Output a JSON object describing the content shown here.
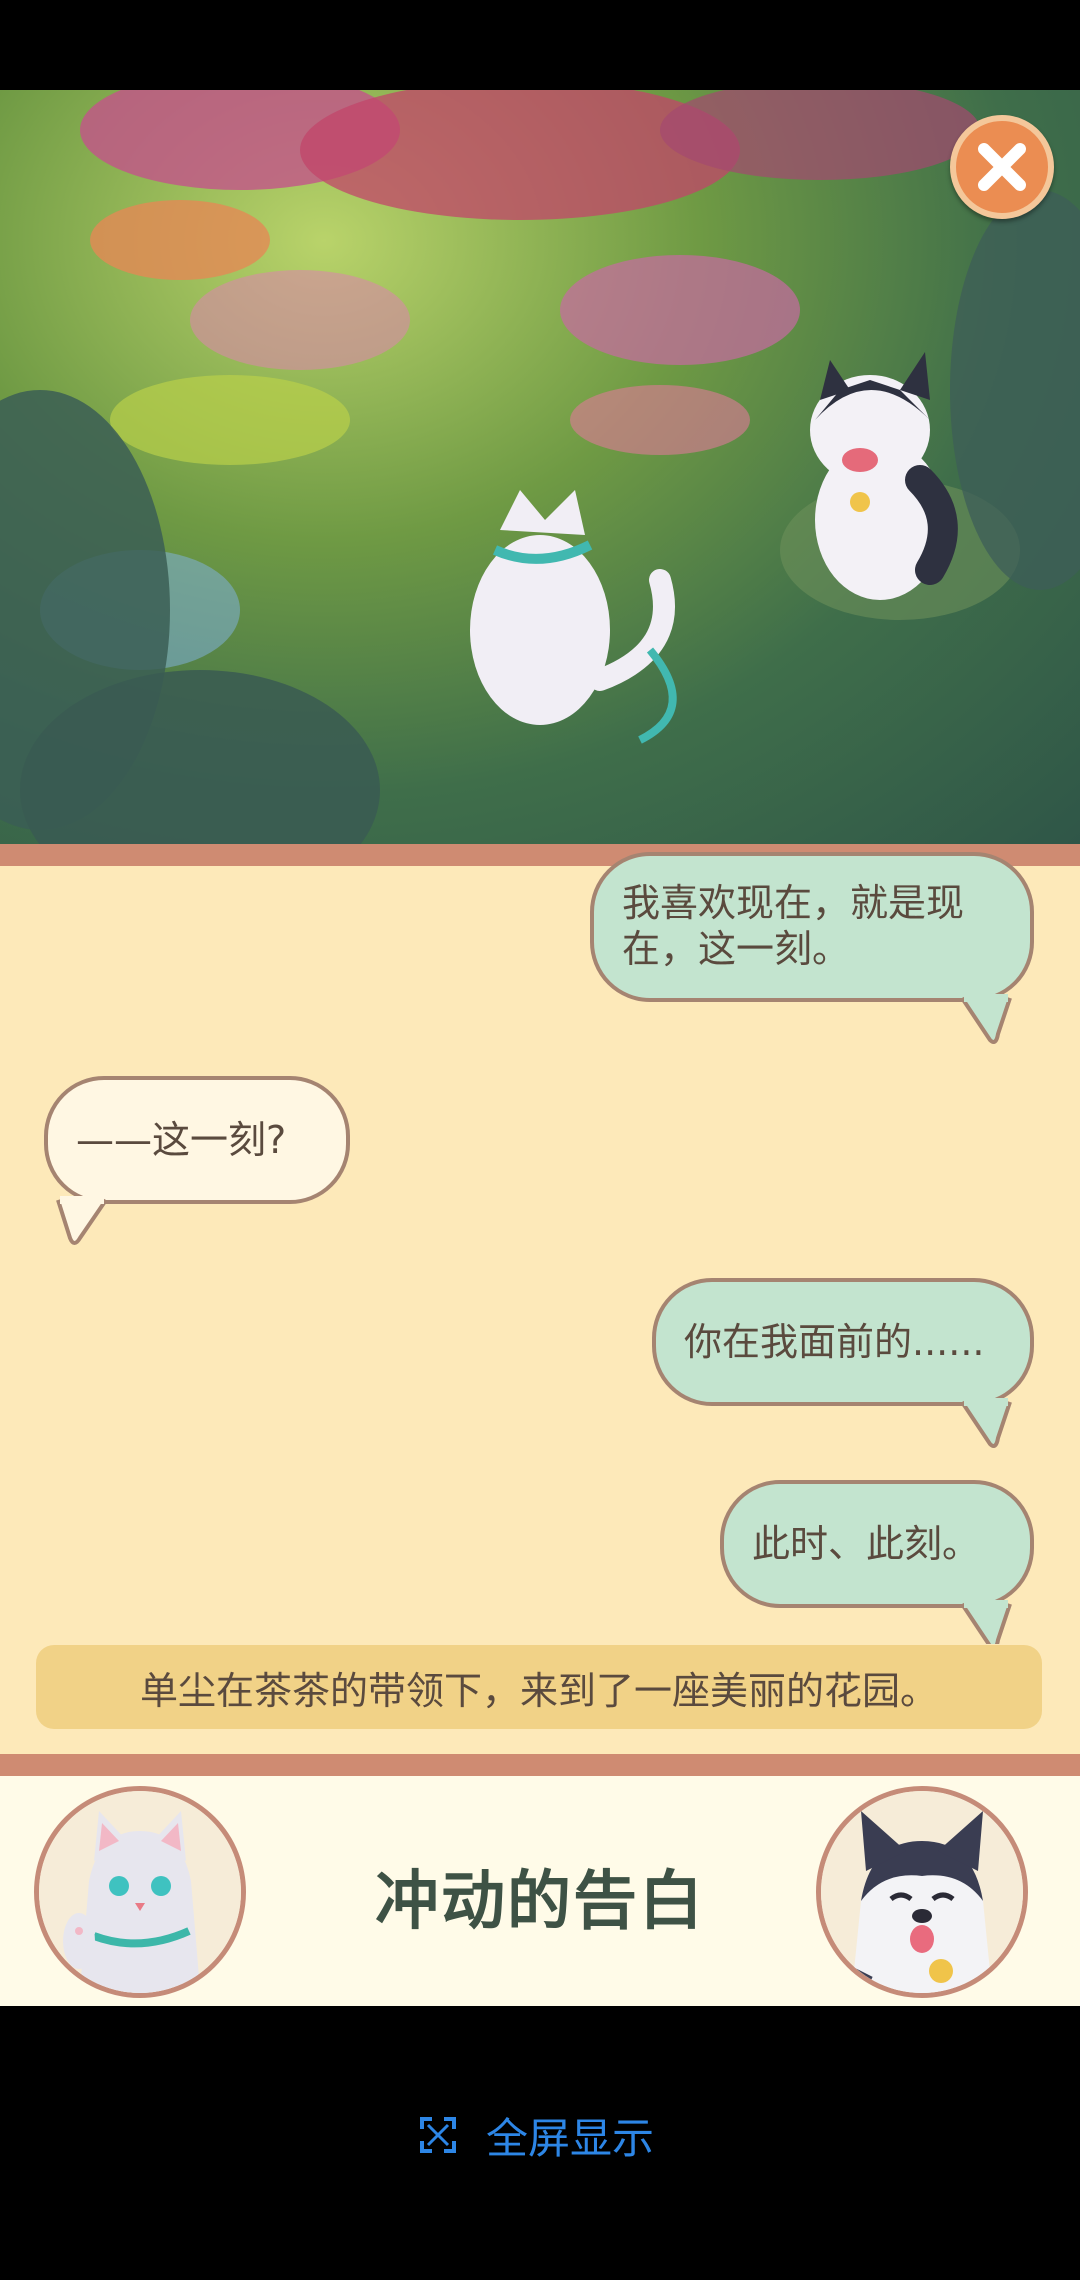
{
  "dialog": {
    "messages": [
      {
        "side": "right",
        "text": "我喜欢现在，就是现在，这一刻。"
      },
      {
        "side": "left",
        "text": "——这一刻?"
      },
      {
        "side": "right",
        "text": "你在我面前的......"
      },
      {
        "side": "right",
        "text": "此时、此刻。"
      }
    ],
    "narration": "单尘在茶茶的带领下，来到了一座美丽的花园。"
  },
  "chapter": {
    "title": "冲动的告白"
  },
  "bottom_bar": {
    "fullscreen_label": "全屏显示"
  },
  "colors": {
    "bubble_right": "#c3e4cf",
    "bubble_left": "#fff7e3",
    "dialog_bg": "#fde9b9",
    "accent_strip": "#cf8b72",
    "link_blue": "#2d86e6",
    "close_button": "#eb8d52"
  },
  "icons": [
    "close-icon",
    "fullscreen-icon",
    "cat-avatar",
    "husky-avatar"
  ]
}
